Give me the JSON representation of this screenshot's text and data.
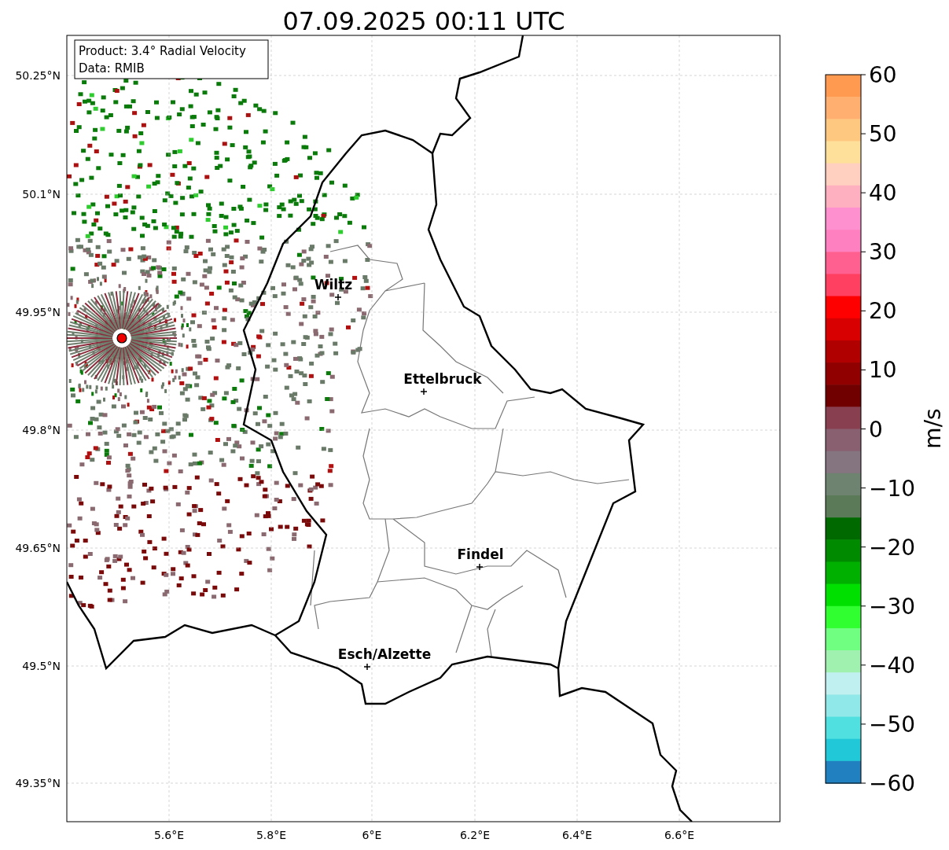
{
  "title": "07.09.2025 00:11 UTC",
  "legend": [
    "Product: 3.4° Radial Velocity",
    "Data: RMIB"
  ],
  "y_ticks": [
    "50.25°N",
    "50.1°N",
    "49.95°N",
    "49.8°N",
    "49.65°N",
    "49.5°N",
    "49.35°N"
  ],
  "x_ticks": [
    "5.6°E",
    "5.8°E",
    "6°E",
    "6.2°E",
    "6.4°E",
    "6.6°E"
  ],
  "places": [
    {
      "name": "Wiltz"
    },
    {
      "name": "Ettelbruck"
    },
    {
      "name": "Findel"
    },
    {
      "name": "Esch/Alzette"
    }
  ],
  "colorbar": {
    "ticks": [
      "60",
      "50",
      "40",
      "30",
      "20",
      "10",
      "0",
      "−10",
      "−20",
      "−30",
      "−40",
      "−50",
      "−60"
    ],
    "label": "m/s"
  }
}
